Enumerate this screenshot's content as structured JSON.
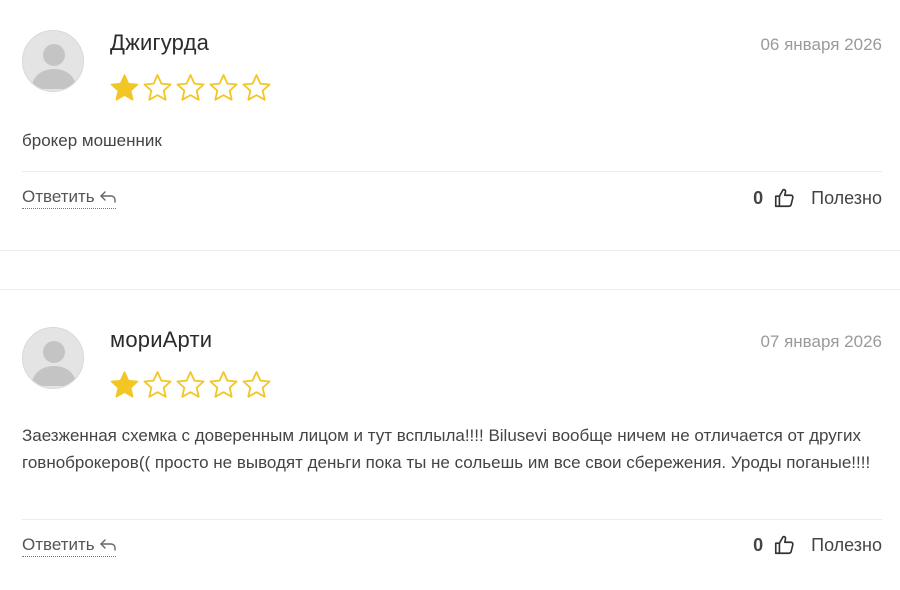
{
  "reviews": [
    {
      "author": "Джигурда",
      "date": "06 января 2026",
      "rating": 1,
      "rating_max": 5,
      "text": "брокер мошенник",
      "reply_label": "Ответить",
      "helpful_count": "0",
      "helpful_label": "Полезно"
    },
    {
      "author": "мориАрти",
      "date": "07 января 2026",
      "rating": 1,
      "rating_max": 5,
      "text": "Заезженная схемка с доверенным лицом и тут всплыла!!!! Bilusevi вообще ничем не отличается от других говноброкеров(( просто не выводят деньги пока ты не сольешь им все свои сбережения. Уроды поганые!!!!",
      "reply_label": "Ответить",
      "helpful_count": "0",
      "helpful_label": "Полезно"
    }
  ],
  "colors": {
    "star_filled": "#f2c624",
    "star_outline": "#f2c624",
    "avatar_bg": "#e4e4e4",
    "avatar_fg": "#c4c4c4",
    "date": "#9a9a9a"
  },
  "icons": {
    "reply": "reply-arrow-icon",
    "like": "thumbs-up-icon",
    "avatar": "user-placeholder-icon"
  }
}
